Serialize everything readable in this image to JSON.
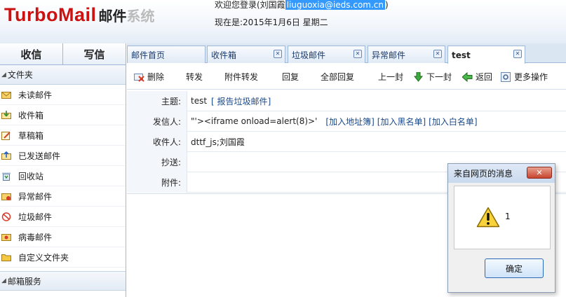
{
  "header": {
    "logo_brand": "TurboMail",
    "logo_mail": "邮件",
    "logo_system": "系统",
    "welcome_prefix": "欢迎您登录(刘国霞",
    "welcome_email": "liuguoxia@ieds.com.cn",
    "welcome_suffix": ")",
    "today": "现在是:2015年1月6日  星期二"
  },
  "sidebar": {
    "inbox_btn": "收信",
    "compose_btn": "写信",
    "folders_title": "文件夹",
    "folders": [
      {
        "label": "未读邮件",
        "icon": "unread-mail-icon"
      },
      {
        "label": "收件箱",
        "icon": "inbox-icon"
      },
      {
        "label": "草稿箱",
        "icon": "drafts-icon"
      },
      {
        "label": "已发送邮件",
        "icon": "sent-icon"
      },
      {
        "label": "回收站",
        "icon": "trash-icon"
      },
      {
        "label": "异常邮件",
        "icon": "abnormal-mail-icon"
      },
      {
        "label": "垃圾邮件",
        "icon": "spam-icon"
      },
      {
        "label": "病毒邮件",
        "icon": "virus-mail-icon"
      },
      {
        "label": "自定义文件夹",
        "icon": "custom-folder-icon"
      }
    ],
    "services_title": "邮箱服务"
  },
  "tabs": [
    {
      "label": "邮件首页",
      "closable": false
    },
    {
      "label": "收件箱",
      "closable": true
    },
    {
      "label": "垃圾邮件",
      "closable": true
    },
    {
      "label": "异常邮件",
      "closable": true
    },
    {
      "label": "test",
      "closable": true,
      "active": true
    }
  ],
  "toolbar": {
    "delete": "删除",
    "forward": "转发",
    "forward_attach": "附件转发",
    "reply": "回复",
    "reply_all": "全部回复",
    "prev": "上一封",
    "next": "下一封",
    "back": "返回",
    "more": "更多操作"
  },
  "mail": {
    "subject_label": "主题:",
    "subject": "test",
    "report_spam": "报告垃圾邮件",
    "from_label": "发信人:",
    "from": "\"'><iframe onload=alert(8)>'",
    "add_contact": "加入地址簿",
    "add_black": "加入黑名单",
    "add_white": "加入白名单",
    "to_label": "收件人:",
    "to": "dttf_js;刘国霞",
    "cc_label": "抄送:",
    "cc": "",
    "attach_label": "附件:",
    "attach": ""
  },
  "dialog": {
    "title": "来自网页的消息",
    "close": "✕",
    "message": "1",
    "ok": "确定"
  },
  "colors": {
    "brand_red": "#cc1111",
    "link_blue": "#1a4a8a",
    "border_blue": "#9fb8d8"
  }
}
